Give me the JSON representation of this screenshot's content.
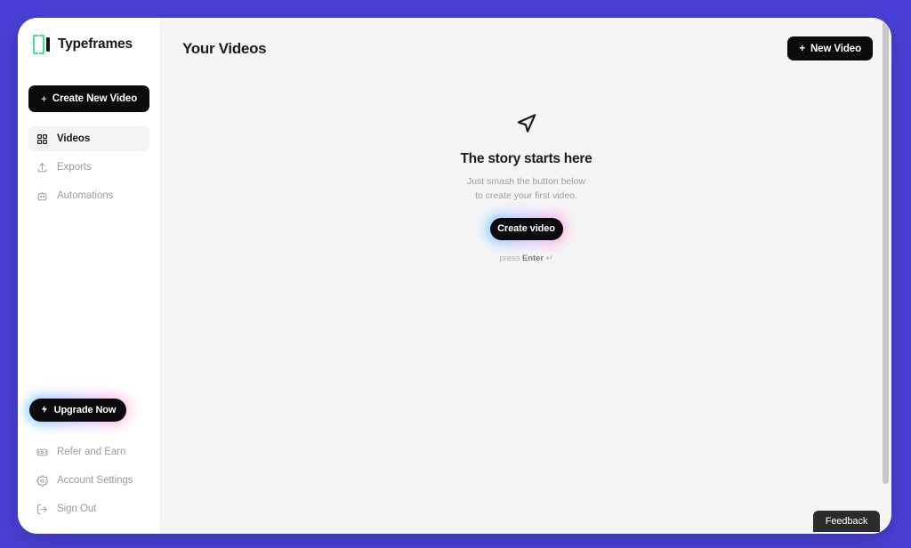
{
  "brand": {
    "name": "Typeframes",
    "logo_icon": "typeframes-brackets-logo",
    "logo_color": "#46e08a"
  },
  "sidebar": {
    "create_button": {
      "label": "Create New Video",
      "icon": "plus-icon"
    },
    "nav_items": [
      {
        "label": "Videos",
        "icon": "grid-icon",
        "active": true
      },
      {
        "label": "Exports",
        "icon": "upload-icon",
        "active": false
      },
      {
        "label": "Automations",
        "icon": "robot-icon",
        "active": false
      }
    ],
    "upgrade_button": {
      "label": "Upgrade Now",
      "icon": "lightning-bolt-icon"
    },
    "bottom_items": [
      {
        "label": "Refer and Earn",
        "icon": "banknote-icon"
      },
      {
        "label": "Account Settings",
        "icon": "gear-icon"
      },
      {
        "label": "Sign Out",
        "icon": "logout-icon"
      }
    ]
  },
  "header": {
    "title": "Your Videos",
    "new_video_button": {
      "label": "New Video",
      "icon": "plus-icon"
    }
  },
  "empty_state": {
    "icon": "navigation-arrow-icon",
    "title": "The story starts here",
    "subtitle_line1": "Just smash the button below",
    "subtitle_line2": "to create your first video.",
    "cta_label": "Create video",
    "hint_prefix": "press ",
    "hint_key": "Enter",
    "hint_suffix": " ↵"
  },
  "feedback": {
    "label": "Feedback"
  },
  "colors": {
    "page_background": "#4840d4",
    "card_background": "#ffffff",
    "main_background": "#f5f5f6",
    "button_dark": "#0b0b0d",
    "active_nav_background": "#f4f4f5",
    "muted_text": "#9a9aa4"
  },
  "symbols": {
    "plus": "+"
  }
}
